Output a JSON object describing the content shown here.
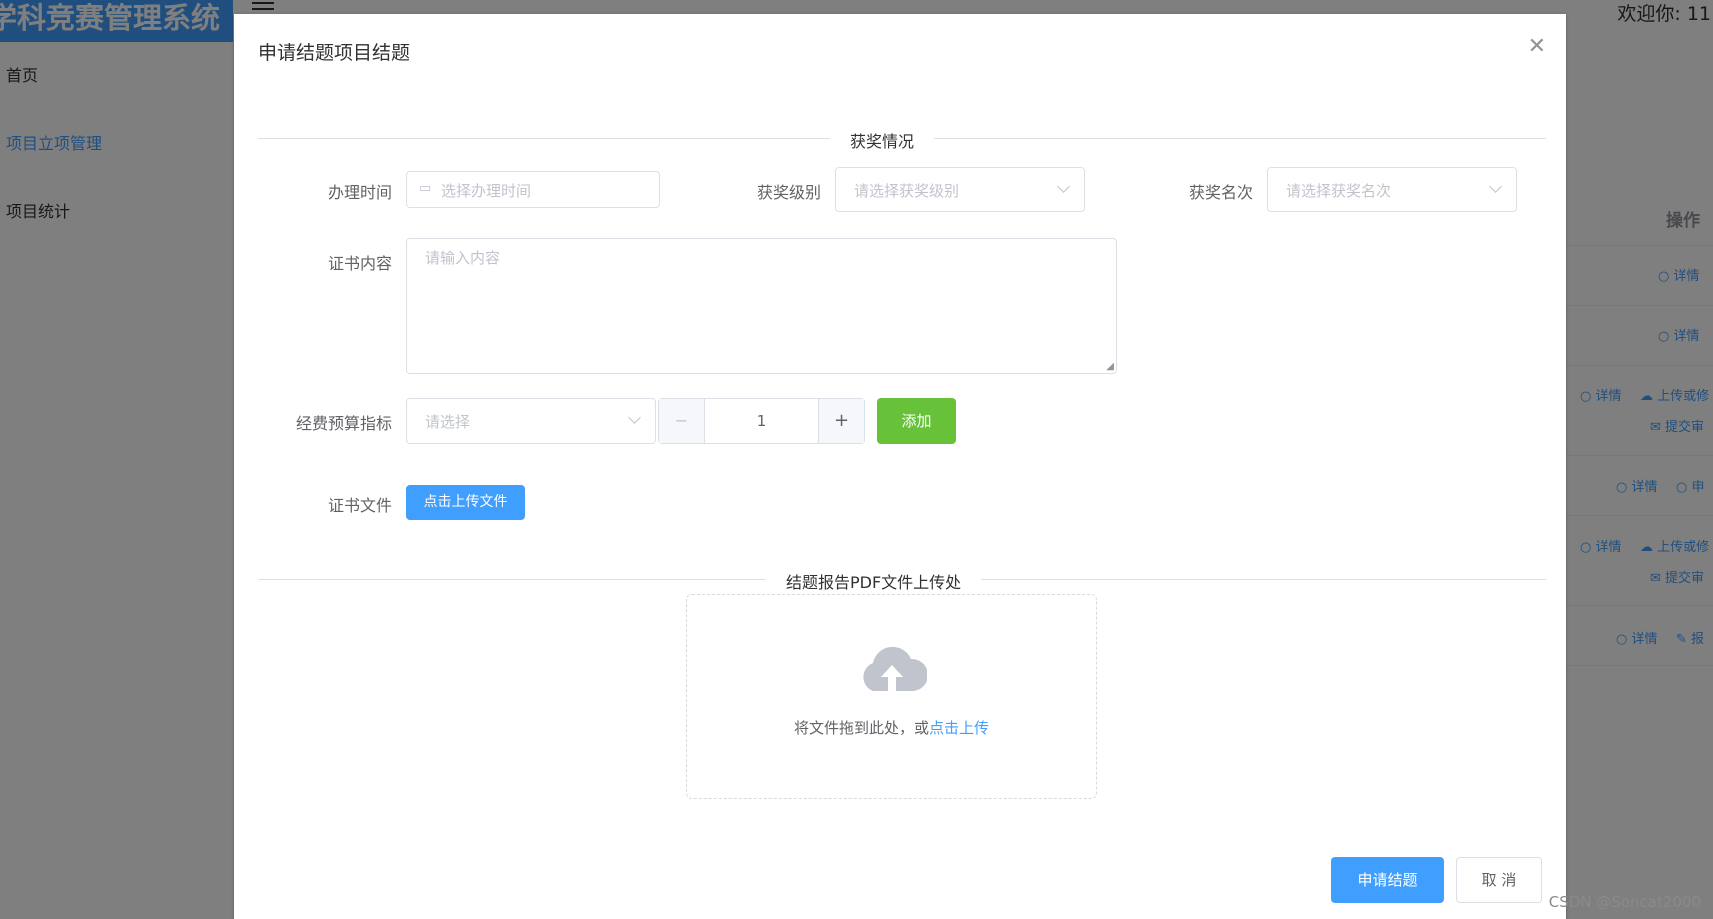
{
  "app": {
    "title": "学科竞赛管理系统",
    "welcome": "欢迎你: 11"
  },
  "sidebar": {
    "items": [
      {
        "label": "首页"
      },
      {
        "label": "项目立项管理"
      },
      {
        "label": "项目统计"
      }
    ]
  },
  "table": {
    "operation_header": "操作",
    "row_actions": [
      [
        "详情"
      ],
      [
        "详情"
      ],
      [
        "详情",
        "上传或修",
        "提交审"
      ],
      [
        "详情",
        "申"
      ],
      [
        "详情",
        "上传或修",
        "提交审"
      ],
      [
        "详情",
        "报"
      ]
    ]
  },
  "dialog": {
    "title": "申请结题项目结题",
    "section_award": "获奖情况",
    "handle_time_label": "办理时间",
    "handle_time_placeholder": "选择办理时间",
    "award_level_label": "获奖级别",
    "award_level_placeholder": "请选择获奖级别",
    "award_rank_label": "获奖名次",
    "award_rank_placeholder": "请选择获奖名次",
    "certificate_content_label": "证书内容",
    "certificate_content_placeholder": "请输入内容",
    "budget_label": "经费预算指标",
    "budget_placeholder": "请选择",
    "budget_quantity": "1",
    "add_button": "添加",
    "certificate_file_label": "证书文件",
    "upload_file_button": "点击上传文件",
    "section_report": "结题报告PDF文件上传处",
    "drag_text": "将文件拖到此处，或",
    "drag_link": "点击上传",
    "submit_button": "申请结题",
    "cancel_button": "取 消"
  },
  "watermark": "CSDN @Soncat2000",
  "colors": {
    "primary": "#409eff",
    "success": "#67c23a"
  }
}
